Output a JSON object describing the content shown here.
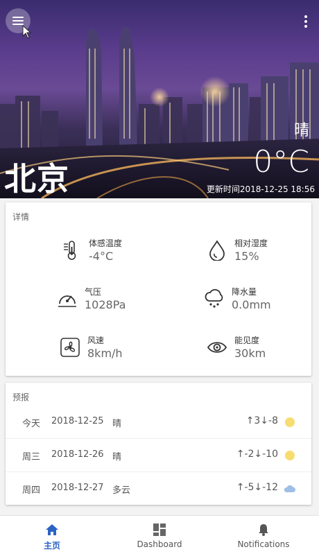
{
  "header": {
    "city": "北京",
    "weather": "晴",
    "temperature": "0°C",
    "update_time": "更新时间2018-12-25 18:56"
  },
  "details": {
    "title": "详情",
    "items": [
      {
        "label": "体感温度",
        "value": "-4°C",
        "icon": "thermometer-icon"
      },
      {
        "label": "相对湿度",
        "value": "15%",
        "icon": "humidity-drop-icon"
      },
      {
        "label": "气压",
        "value": "1028Pa",
        "icon": "gauge-icon"
      },
      {
        "label": "降水量",
        "value": "0.0mm",
        "icon": "rain-cloud-icon"
      },
      {
        "label": "风速",
        "value": "8km/h",
        "icon": "fan-icon"
      },
      {
        "label": "能见度",
        "value": "30km",
        "icon": "eye-icon"
      }
    ]
  },
  "forecast": {
    "title": "预报",
    "rows": [
      {
        "day": "今天",
        "date": "2018-12-25",
        "desc": "晴",
        "range": "↑3↓-8",
        "icon": "sun-icon"
      },
      {
        "day": "周三",
        "date": "2018-12-26",
        "desc": "晴",
        "range": "↑-2↓-10",
        "icon": "sun-icon"
      },
      {
        "day": "周四",
        "date": "2018-12-27",
        "desc": "多云",
        "range": "↑-5↓-12",
        "icon": "cloud-icon"
      }
    ]
  },
  "nav": {
    "items": [
      {
        "label": "主页",
        "icon": "home-icon",
        "active": true
      },
      {
        "label": "Dashboard",
        "icon": "dashboard-icon",
        "active": false
      },
      {
        "label": "Notifications",
        "icon": "bell-icon",
        "active": false
      }
    ]
  },
  "colors": {
    "accent": "#2b63c4",
    "sun": "#f7dc6f",
    "cloud": "#9fbfe6"
  }
}
